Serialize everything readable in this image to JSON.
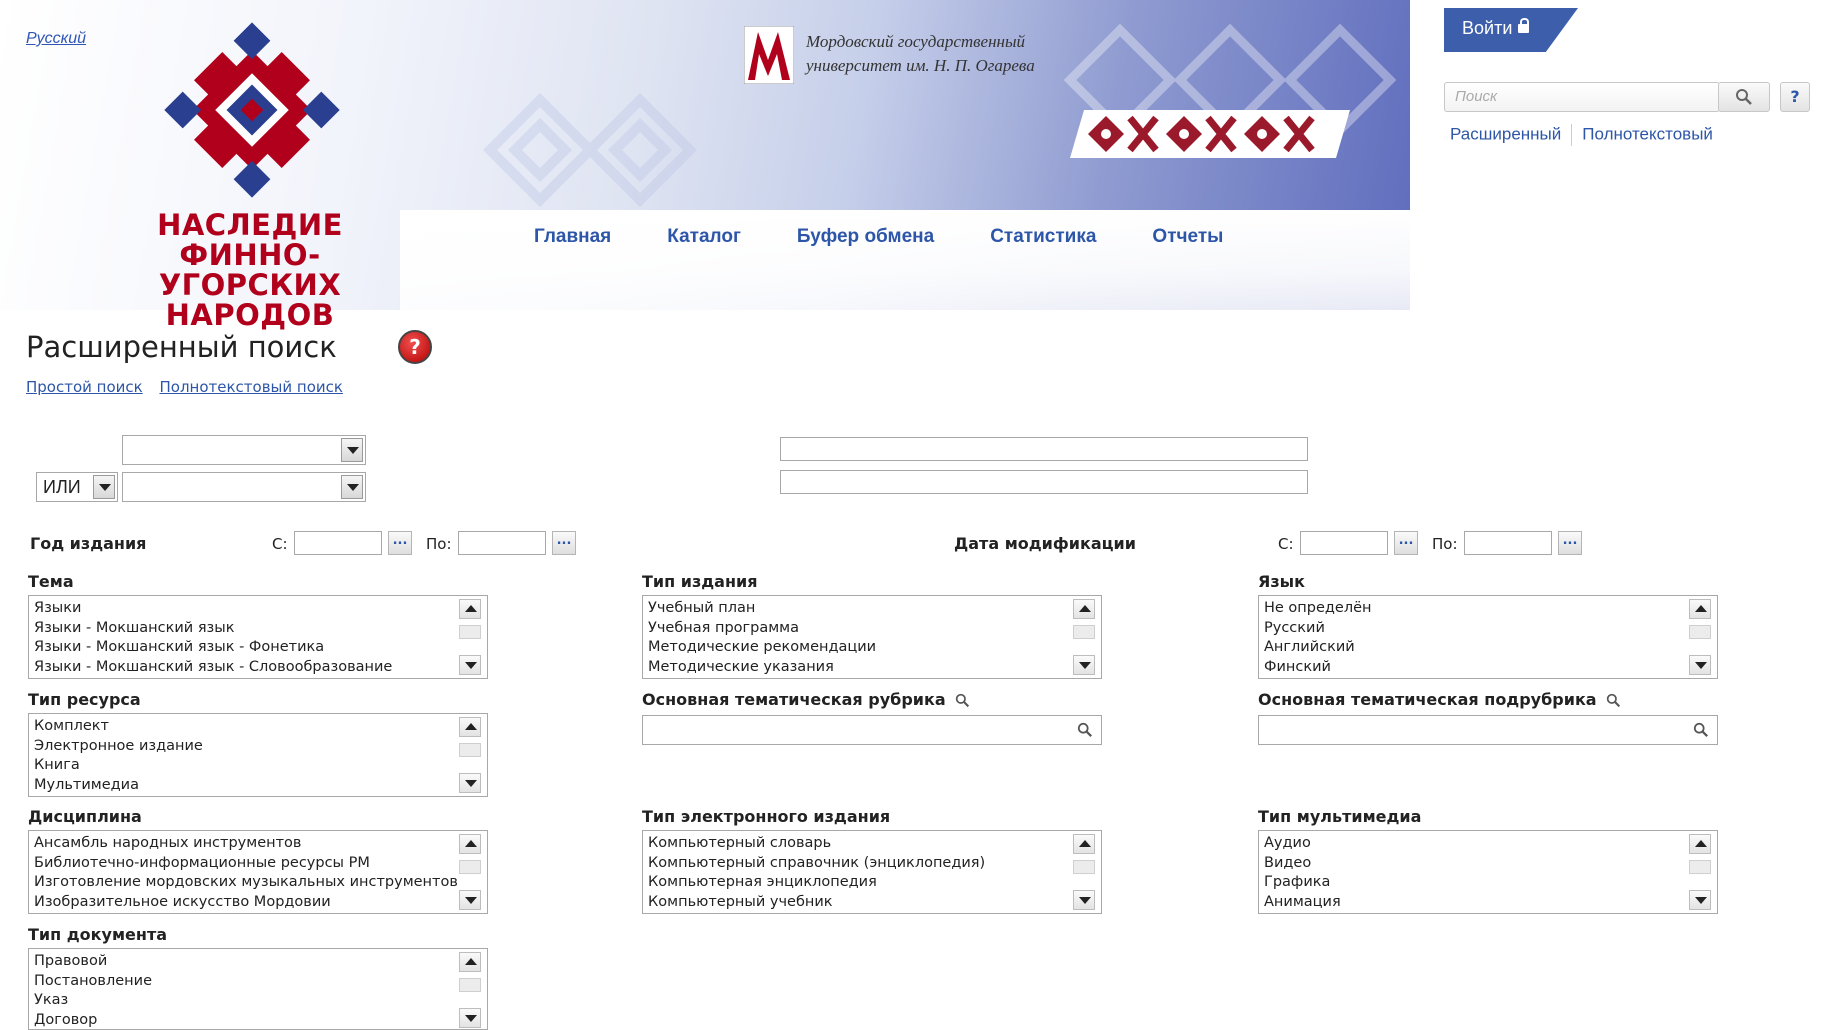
{
  "header": {
    "language_link": "Русский",
    "site_title": [
      "НАСЛЕДИЕ",
      "ФИННО-УГОРСКИХ",
      "НАРОДОВ"
    ],
    "university_name": [
      "Мордовский государственный",
      "университет им. Н. П. Огарева"
    ],
    "nav": [
      "Главная",
      "Каталог",
      "Буфер обмена",
      "Статистика",
      "Отчеты"
    ],
    "login_label": "Войти",
    "search_placeholder": "Поиск",
    "help_label": "?",
    "extended_link": "Расширенный",
    "fulltext_link": "Полнотекстовый",
    "colors": {
      "brand_red": "#b1001c",
      "nav_blue": "#2d56a8",
      "login_bg": "#3d5fab"
    }
  },
  "page": {
    "title": "Расширенный поиск",
    "help_icon": "?",
    "simple_search_link": "Простой поиск",
    "fulltext_search_link": "Полнотекстовый поиск"
  },
  "criteria": {
    "field1_value": "",
    "operator": "ИЛИ",
    "field2_value": "",
    "text1": "",
    "text2": ""
  },
  "dates": {
    "pub_year_label": "Год издания",
    "mod_date_label": "Дата модификации",
    "from_label": "С:",
    "to_label": "По:",
    "picker_label": "..."
  },
  "lists": {
    "topic": {
      "label": "Тема",
      "items": [
        "Языки",
        "Языки - Мокшанский язык",
        "Языки - Мокшанский язык - Фонетика",
        "Языки - Мокшанский язык - Словообразование"
      ]
    },
    "pub_type": {
      "label": "Тип издания",
      "items": [
        "Учебный план",
        "Учебная программа",
        "Методические рекомендации",
        "Методические указания"
      ]
    },
    "language": {
      "label": "Язык",
      "items": [
        "Не определён",
        "Русский",
        "Английский",
        "Финский"
      ]
    },
    "resource_type": {
      "label": "Тип ресурса",
      "items": [
        "Комплект",
        "Электронное издание",
        "Книга",
        "Мультимедиа"
      ]
    },
    "main_rubric": {
      "label": "Основная тематическая рубрика"
    },
    "main_subrubric": {
      "label": "Основная тематическая подрубрика"
    },
    "discipline": {
      "label": "Дисциплина",
      "items": [
        "Ансамбль народных инструментов",
        "Библиотечно-информационные ресурсы РМ",
        "Изготовление мордовских музыкальных инструментов",
        "Изобразительное искусство Мордовии"
      ]
    },
    "epub_type": {
      "label": "Тип электронного издания",
      "items": [
        "Компьютерный словарь",
        "Компьютерный справочник (энциклопедия)",
        "Компьютерная энциклопедия",
        "Компьютерный учебник"
      ]
    },
    "media_type": {
      "label": "Тип мультимедиа",
      "items": [
        "Аудио",
        "Видео",
        "Графика",
        "Анимация"
      ]
    },
    "doc_type": {
      "label": "Тип документа",
      "items": [
        "Правовой",
        "Постановление",
        "Указ",
        "Договор"
      ]
    }
  }
}
